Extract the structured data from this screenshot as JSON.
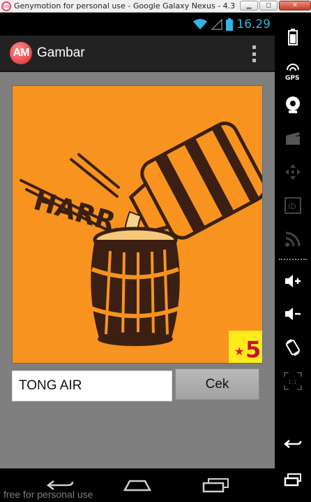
{
  "window": {
    "title": "Genymotion for personal use - Google Galaxy Nexus - 4.3 ...",
    "minimize_label": "▁",
    "maximize_label": "◻",
    "close_label": "✕"
  },
  "status_bar": {
    "time": "16.29",
    "icons": [
      "wifi-icon",
      "signal-icon",
      "battery-icon"
    ]
  },
  "action_bar": {
    "logo_text": "AM",
    "title": "Gambar",
    "overflow_icon": "overflow-menu-icon"
  },
  "puzzle": {
    "image_text": "HARR...",
    "badge_text": "5",
    "answer_value": "TONG AIR",
    "check_button_label": "Cek"
  },
  "nav_bar": {
    "icons": [
      "back-icon",
      "home-icon",
      "recent-apps-icon"
    ]
  },
  "watermark": "free for personal use",
  "side_toolbar": {
    "icons": [
      "battery-icon",
      "gps-icon",
      "camera-icon",
      "media-icon",
      "dpad-icon",
      "id-icon",
      "rss-icon",
      "volume-up-icon",
      "volume-down-icon",
      "rotate-icon",
      "scale-icon",
      "back-icon",
      "menu-icon"
    ],
    "gps_label": "GPS",
    "id_label": "ID",
    "scale_label": "1:1"
  },
  "colors": {
    "accent": "#33b5e5",
    "picture_bg": "#f7931e",
    "content_bg": "#7f7f7f",
    "action_bar_bg": "#222222"
  }
}
